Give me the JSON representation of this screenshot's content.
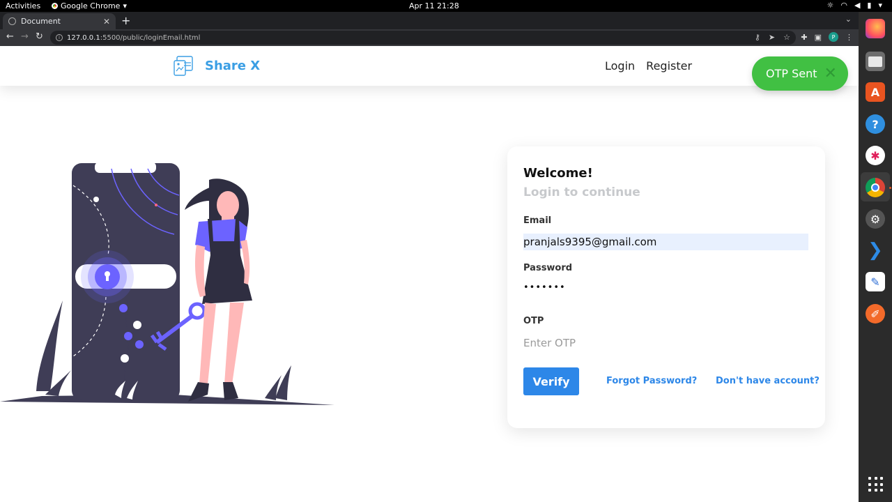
{
  "gnome": {
    "activities": "Activities",
    "app_name": "Google Chrome",
    "clock": "Apr 11  21:28"
  },
  "browser": {
    "tab_title": "Document",
    "url_host": "127.0.0.1",
    "url_rest": ":5500/public/loginEmail.html",
    "profile_initial": "P"
  },
  "dock": {
    "apps": [
      "Firefox",
      "Files",
      "Ubuntu Software",
      "Help",
      "Slack",
      "Google Chrome",
      "Settings",
      "VS Code",
      "Text Editor",
      "Inkscape"
    ]
  },
  "header": {
    "brand": "Share X",
    "nav_login": "Login",
    "nav_register": "Register"
  },
  "toast": {
    "text": "OTP Sent",
    "color": "#41c043"
  },
  "form": {
    "welcome": "Welcome!",
    "subtitle": "Login to continue",
    "email_label": "Email",
    "email_value": "pranjals9395@gmail.com",
    "password_label": "Password",
    "password_value": "•••••••",
    "otp_label": "OTP",
    "otp_placeholder": "Enter OTP",
    "verify_label": "Verify",
    "forgot_link": "Forgot Password?",
    "signup_link": "Don't have account?"
  },
  "colors": {
    "accent": "#2d87e8",
    "brand": "#3a9ee4",
    "illustration_dark": "#3f3d56",
    "illustration_accent": "#6c63ff"
  }
}
